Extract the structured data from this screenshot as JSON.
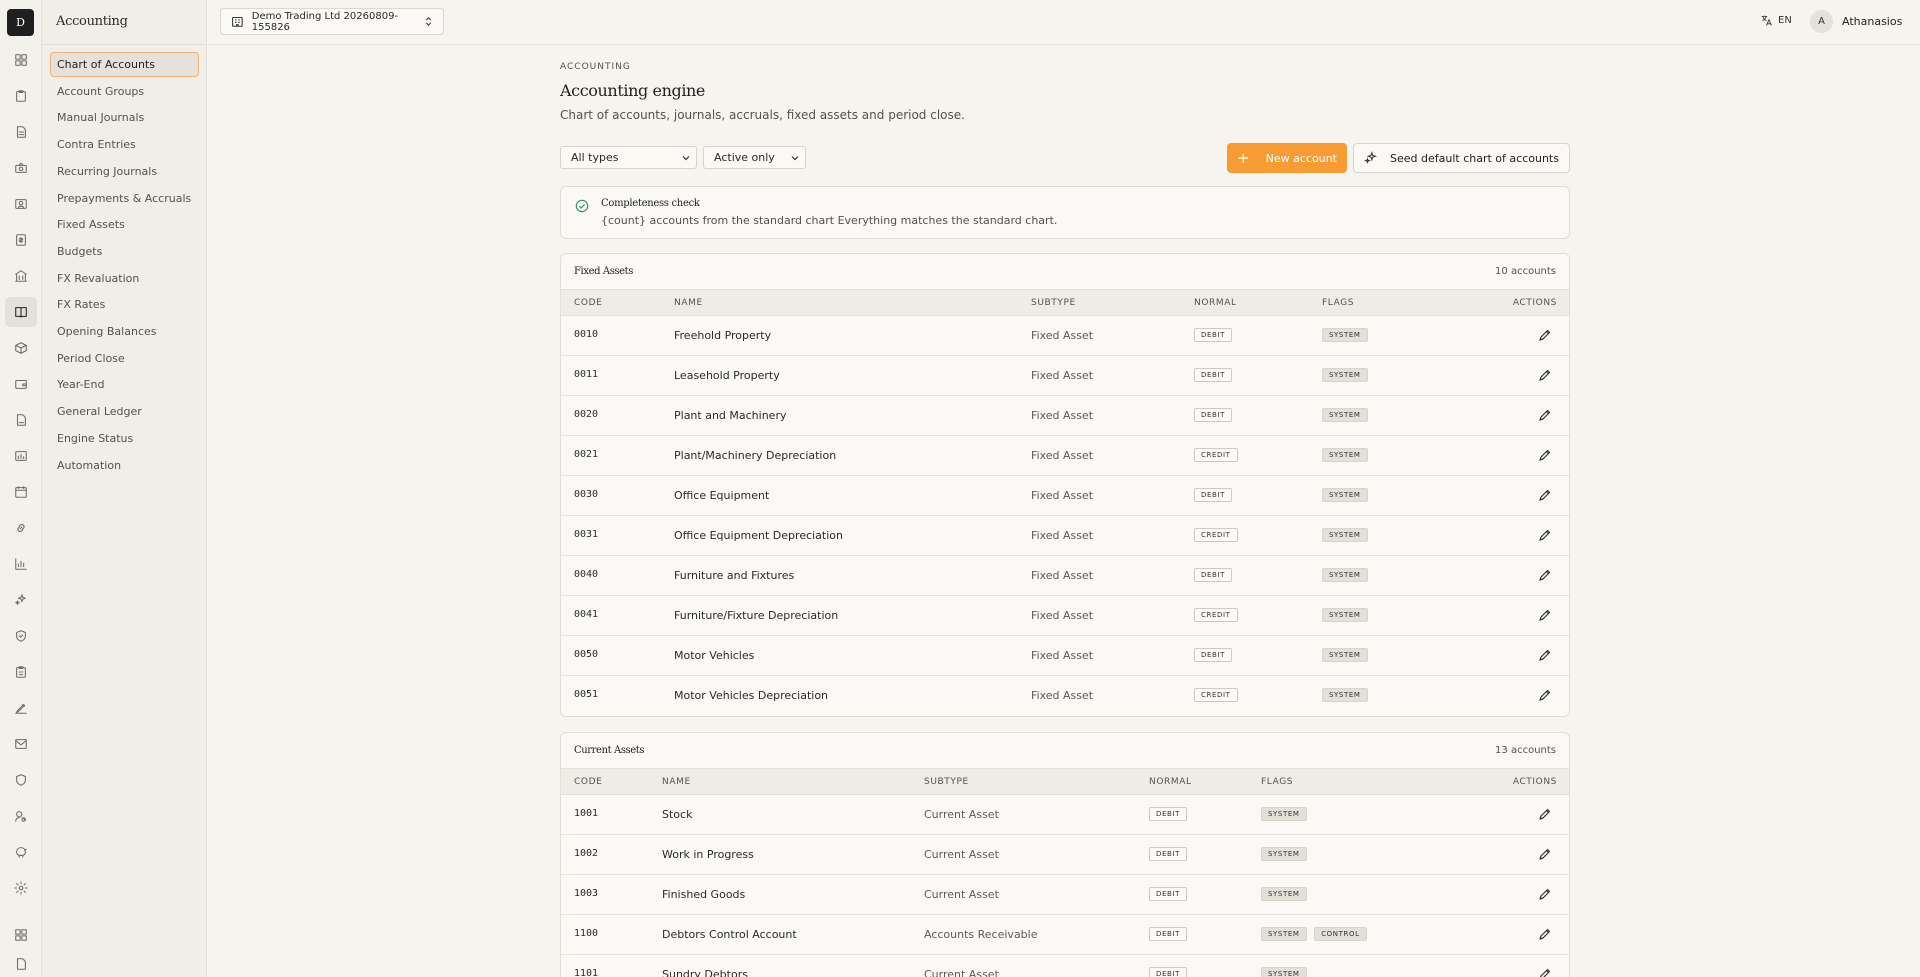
{
  "app": {
    "logo_letter": "D"
  },
  "sidebar": {
    "title": "Accounting",
    "items": [
      {
        "label": "Chart of Accounts",
        "active": true
      },
      {
        "label": "Account Groups"
      },
      {
        "label": "Manual Journals"
      },
      {
        "label": "Contra Entries"
      },
      {
        "label": "Recurring Journals"
      },
      {
        "label": "Prepayments & Accruals"
      },
      {
        "label": "Fixed Assets"
      },
      {
        "label": "Budgets"
      },
      {
        "label": "FX Revaluation"
      },
      {
        "label": "FX Rates"
      },
      {
        "label": "Opening Balances"
      },
      {
        "label": "Period Close"
      },
      {
        "label": "Year-End"
      },
      {
        "label": "General Ledger"
      },
      {
        "label": "Engine Status"
      },
      {
        "label": "Automation"
      }
    ]
  },
  "topbar": {
    "company": "Demo Trading Ltd 20260809-155826",
    "language": "EN",
    "avatar_initial": "A",
    "user_name": "Athanasios"
  },
  "header": {
    "eyebrow": "ACCOUNTING",
    "title": "Accounting engine",
    "subtitle": "Chart of accounts, journals, accruals, fixed assets and period close."
  },
  "filters": {
    "type_select": "All types",
    "status_select": "Active only"
  },
  "actions": {
    "new_account": "New account",
    "seed_default": "Seed default chart of accounts"
  },
  "completeness": {
    "title": "Completeness check",
    "text": "{count} accounts from the standard chart Everything matches the standard chart."
  },
  "columns": {
    "code": "CODE",
    "name": "NAME",
    "subtype": "SUBTYPE",
    "normal": "NORMAL",
    "flags": "FLAGS",
    "actions": "ACTIONS"
  },
  "groups": [
    {
      "title": "Fixed Assets",
      "count": "10 accounts",
      "rows": [
        {
          "code": "0010",
          "name": "Freehold Property",
          "subtype": "Fixed Asset",
          "normal": "DEBIT",
          "flags": [
            "SYSTEM"
          ]
        },
        {
          "code": "0011",
          "name": "Leasehold Property",
          "subtype": "Fixed Asset",
          "normal": "DEBIT",
          "flags": [
            "SYSTEM"
          ]
        },
        {
          "code": "0020",
          "name": "Plant and Machinery",
          "subtype": "Fixed Asset",
          "normal": "DEBIT",
          "flags": [
            "SYSTEM"
          ]
        },
        {
          "code": "0021",
          "name": "Plant/Machinery Depreciation",
          "subtype": "Fixed Asset",
          "normal": "CREDIT",
          "flags": [
            "SYSTEM"
          ]
        },
        {
          "code": "0030",
          "name": "Office Equipment",
          "subtype": "Fixed Asset",
          "normal": "DEBIT",
          "flags": [
            "SYSTEM"
          ]
        },
        {
          "code": "0031",
          "name": "Office Equipment Depreciation",
          "subtype": "Fixed Asset",
          "normal": "CREDIT",
          "flags": [
            "SYSTEM"
          ]
        },
        {
          "code": "0040",
          "name": "Furniture and Fixtures",
          "subtype": "Fixed Asset",
          "normal": "DEBIT",
          "flags": [
            "SYSTEM"
          ]
        },
        {
          "code": "0041",
          "name": "Furniture/Fixture Depreciation",
          "subtype": "Fixed Asset",
          "normal": "CREDIT",
          "flags": [
            "SYSTEM"
          ]
        },
        {
          "code": "0050",
          "name": "Motor Vehicles",
          "subtype": "Fixed Asset",
          "normal": "DEBIT",
          "flags": [
            "SYSTEM"
          ]
        },
        {
          "code": "0051",
          "name": "Motor Vehicles Depreciation",
          "subtype": "Fixed Asset",
          "normal": "CREDIT",
          "flags": [
            "SYSTEM"
          ]
        }
      ]
    },
    {
      "title": "Current Assets",
      "count": "13 accounts",
      "rows": [
        {
          "code": "1001",
          "name": "Stock",
          "subtype": "Current Asset",
          "normal": "DEBIT",
          "flags": [
            "SYSTEM"
          ]
        },
        {
          "code": "1002",
          "name": "Work in Progress",
          "subtype": "Current Asset",
          "normal": "DEBIT",
          "flags": [
            "SYSTEM"
          ]
        },
        {
          "code": "1003",
          "name": "Finished Goods",
          "subtype": "Current Asset",
          "normal": "DEBIT",
          "flags": [
            "SYSTEM"
          ]
        },
        {
          "code": "1100",
          "name": "Debtors Control Account",
          "subtype": "Accounts Receivable",
          "normal": "DEBIT",
          "flags": [
            "SYSTEM",
            "CONTROL"
          ]
        },
        {
          "code": "1101",
          "name": "Sundry Debtors",
          "subtype": "Current Asset",
          "normal": "DEBIT",
          "flags": [
            "SYSTEM"
          ]
        }
      ]
    }
  ],
  "rail_icons": [
    "grid-icon",
    "clipboard-icon",
    "document-icon",
    "camera-icon",
    "contact-card-icon",
    "receipt-icon",
    "bank-icon",
    "book-icon",
    "box-icon",
    "wallet-icon",
    "file-icon",
    "chart-file-icon",
    "calendar-icon",
    "link-icon",
    "bar-chart-icon",
    "sparkles-icon",
    "shield-check-icon",
    "clipboard-list-icon",
    "pen-icon",
    "mail-icon",
    "shield-icon",
    "user-search-icon",
    "piggy-bank-icon",
    "gear-icon",
    "apps-icon",
    "file-bottom-icon"
  ],
  "colors": {
    "accent": "#f79b33",
    "active_border": "#f0b27a",
    "background": "#f6f4ef"
  }
}
